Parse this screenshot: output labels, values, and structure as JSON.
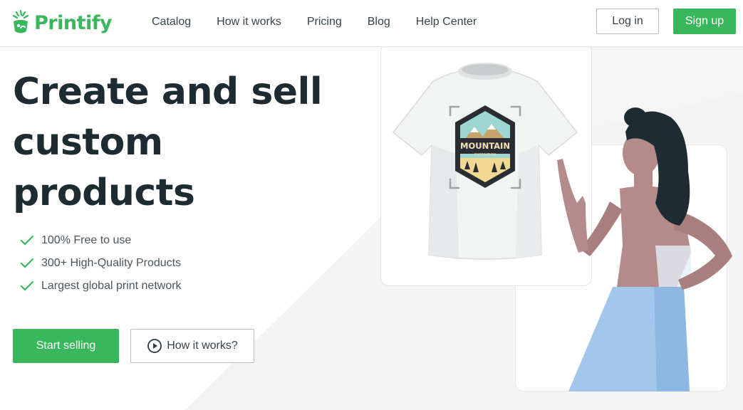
{
  "header": {
    "logo_text": "Printify",
    "nav": [
      {
        "label": "Catalog"
      },
      {
        "label": "How it works"
      },
      {
        "label": "Pricing"
      },
      {
        "label": "Blog"
      },
      {
        "label": "Help Center"
      }
    ],
    "login_label": "Log in",
    "signup_label": "Sign up"
  },
  "hero": {
    "title": "Create and sell custom products",
    "features": [
      {
        "text": "100% Free to use",
        "icon": "check-icon"
      },
      {
        "text": "300+ High-Quality Products",
        "icon": "check-icon"
      },
      {
        "text": "Largest global print network",
        "icon": "check-icon"
      }
    ],
    "start_label": "Start selling",
    "how_label": "How it works?",
    "how_icon": "play-circle-icon"
  },
  "illustration": {
    "design_title": "MOUNTAIN",
    "design_subtitle": "EXPEDITION"
  },
  "colors": {
    "brand_green": "#39b75d",
    "heading": "#1d2b33",
    "text": "#4a555c"
  }
}
